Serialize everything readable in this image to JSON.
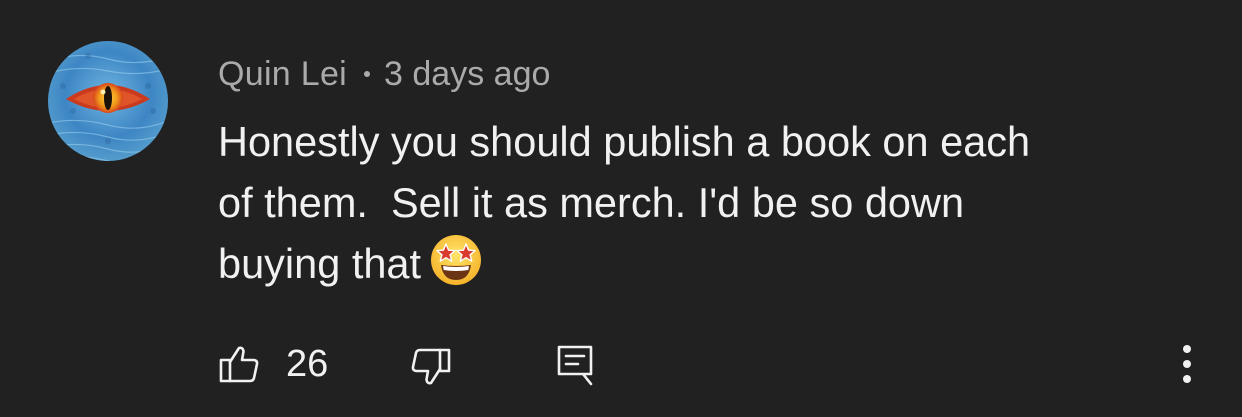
{
  "comment": {
    "author": "Quin Lei",
    "separator": "•",
    "timestamp": "3 days ago",
    "text_lines": [
      "Honestly you should publish a book on each",
      "of them.  Sell it as merch. I'd be so down",
      "buying that"
    ],
    "emoji_icon": "star-struck-emoji",
    "avatar_icon": "reptile-eye-avatar"
  },
  "actions": {
    "like_icon": "thumbs-up-icon",
    "like_count": "26",
    "dislike_icon": "thumbs-down-icon",
    "reply_icon": "reply-icon",
    "more_icon": "more-vertical-icon"
  },
  "colors": {
    "background": "#212121",
    "primary_text": "#f1f1f1",
    "secondary_text": "#aaaaaa"
  }
}
